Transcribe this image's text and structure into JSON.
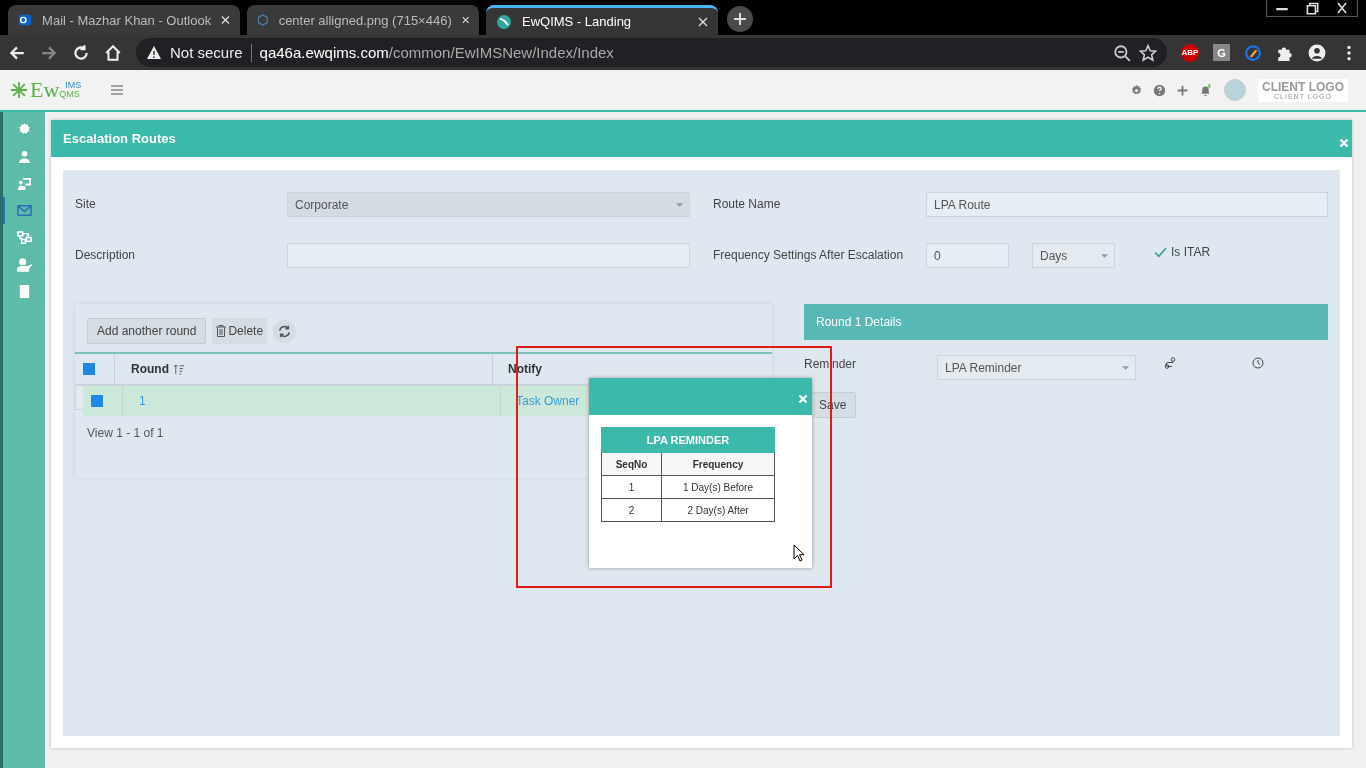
{
  "browser": {
    "tabs": [
      {
        "title": "Mail - Mazhar Khan - Outlook",
        "kind": "mail",
        "selected": false
      },
      {
        "title": "center alligned.png (715×446)",
        "kind": "image",
        "selected": false
      },
      {
        "title": "EwQIMS - Landing",
        "kind": "app",
        "selected": true
      }
    ],
    "address": {
      "security": "Not secure",
      "host": "qa46a.ewqims.com",
      "path": "/common/EwIMSNew/Index/Index"
    },
    "extensions": [
      "ABP",
      "G"
    ]
  },
  "header": {
    "logo": {
      "main": "Ew",
      "top": "IMS",
      "bottom": "QMS"
    },
    "client_logo": "CLIENT LOGO",
    "client_logo_sub": "CLIENT LOGO"
  },
  "sidebar": {
    "items": [
      {
        "kind": "settings",
        "selected": false
      },
      {
        "kind": "user",
        "selected": false
      },
      {
        "kind": "presenter",
        "selected": false
      },
      {
        "kind": "mail",
        "selected": true
      },
      {
        "kind": "hierarchy",
        "selected": false
      },
      {
        "kind": "user-check",
        "selected": false
      },
      {
        "kind": "building",
        "selected": false
      }
    ]
  },
  "panel": {
    "title": "Escalation Routes",
    "form": {
      "site_label": "Site",
      "site_value": "Corporate",
      "route_label": "Route Name",
      "route_value": "LPA Route",
      "description_label": "Description",
      "frequency_label": "Frequency Settings After Escalation",
      "frequency_value": "0",
      "unit_value": "Days",
      "itar_label": "Is ITAR",
      "itar_checked": true
    },
    "toolbar": {
      "add": "Add another round",
      "delete": "Delete"
    },
    "table": {
      "all_checked": true,
      "columns": [
        "Round",
        "Notify"
      ],
      "rows": [
        {
          "checked": true,
          "selected": true,
          "cells": [
            "1",
            "Task Owner"
          ]
        }
      ],
      "footer": "View 1 - 1 of 1"
    },
    "details": {
      "title": "Round 1 Details",
      "reminder_label": "Reminder",
      "reminder_value": "LPA Reminder",
      "save": "Save"
    }
  },
  "popup": {
    "title": "LPA REMINDER",
    "columns": [
      "SeqNo",
      "Frequency"
    ],
    "rows": [
      [
        "1",
        "1 Day(s) Before"
      ],
      [
        "2",
        "2 Day(s) After"
      ]
    ]
  }
}
